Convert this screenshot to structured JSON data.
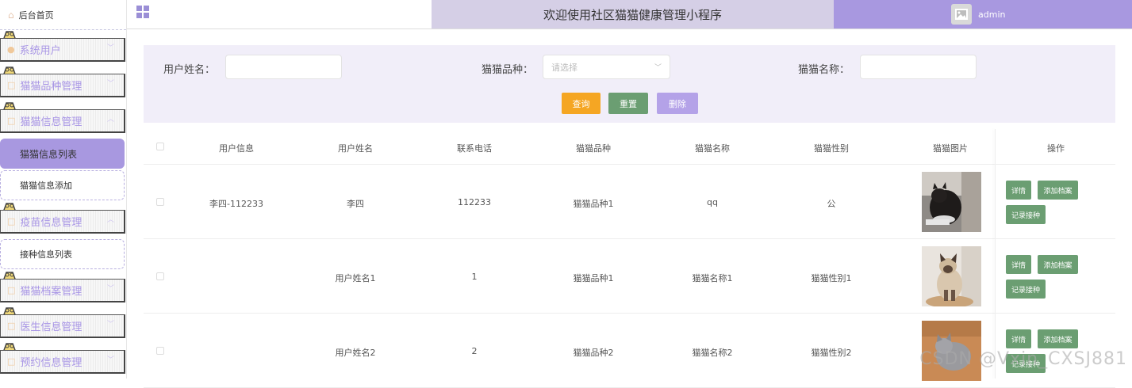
{
  "sidebar": {
    "home_label": "后台首页",
    "groups": [
      {
        "label": "系统用户"
      },
      {
        "label": "猫猫品种管理"
      },
      {
        "label": "猫猫信息管理"
      },
      {
        "label": "疫苗信息管理"
      },
      {
        "label": "猫猫档案管理"
      },
      {
        "label": "医生信息管理"
      },
      {
        "label": "预约信息管理"
      }
    ],
    "sub_items": [
      {
        "label": "猫猫信息列表",
        "active": true
      },
      {
        "label": "猫猫信息添加",
        "active": false
      },
      {
        "label": "接种信息列表",
        "active": false
      }
    ]
  },
  "header": {
    "title": "欢迎使用社区猫猫健康管理小程序",
    "username": "admin"
  },
  "search": {
    "username_label": "用户姓名：",
    "breed_label": "猫猫品种：",
    "breed_placeholder": "请选择",
    "catname_label": "猫猫名称：",
    "query_label": "查询",
    "reset_label": "重置",
    "delete_label": "删除"
  },
  "colors": {
    "accent": "#a898e0",
    "query_button": "#f5a623",
    "reset_button": "#6b9e72",
    "delete_button": "#b4a2e8",
    "action_button": "#6b9e72"
  },
  "table": {
    "columns": [
      "用户信息",
      "用户姓名",
      "联系电话",
      "猫猫品种",
      "猫猫名称",
      "猫猫性别",
      "猫猫图片",
      "操作"
    ],
    "rows": [
      {
        "user_info": "李四-112233",
        "user_name": "李四",
        "phone": "112233",
        "breed": "猫猫品种1",
        "cat_name": "qq",
        "gender": "公"
      },
      {
        "user_info": "",
        "user_name": "用户姓名1",
        "phone": "1",
        "breed": "猫猫品种1",
        "cat_name": "猫猫名称1",
        "gender": "猫猫性别1"
      },
      {
        "user_info": "",
        "user_name": "用户姓名2",
        "phone": "2",
        "breed": "猫猫品种2",
        "cat_name": "猫猫名称2",
        "gender": "猫猫性别2"
      }
    ],
    "actions": {
      "detail": "详情",
      "add_archive": "添加档案",
      "record_vaccine": "记录接种"
    }
  },
  "watermark": "CSDN @Vxin_CXSJ881"
}
